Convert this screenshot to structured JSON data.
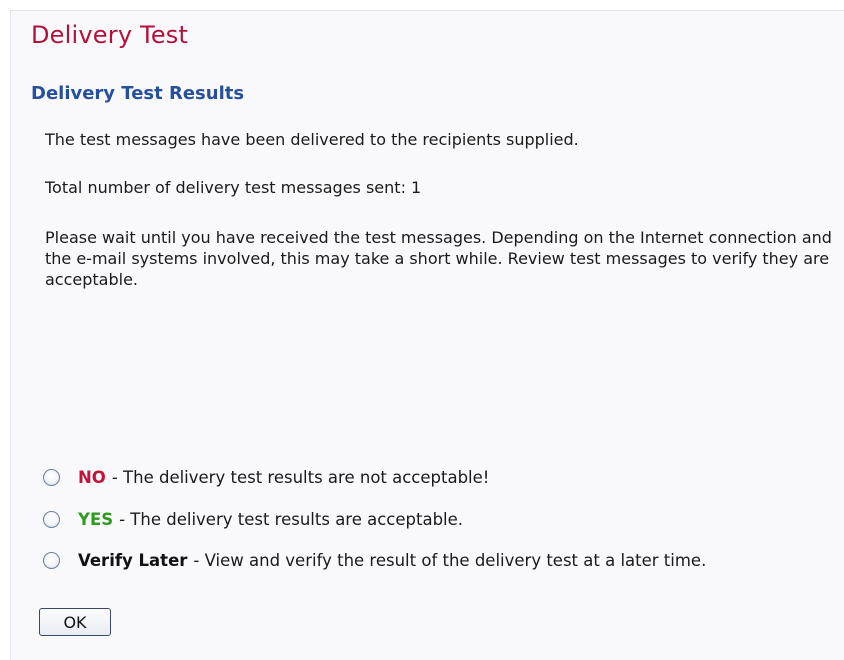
{
  "page": {
    "title": "Delivery Test",
    "subtitle": "Delivery Test Results"
  },
  "body": {
    "line1": "The test messages have been delivered to the recipients supplied.",
    "line2": "Total number of delivery test messages sent: 1",
    "line3": "Please wait until you have received the test messages. Depending on the Internet connection and the e-mail systems involved, this may take a short while. Review test messages to verify they are acceptable."
  },
  "options": [
    {
      "keyword": "NO",
      "text": "- The delivery test results are not acceptable!",
      "color": "#c0143c",
      "selected": false
    },
    {
      "keyword": "YES",
      "text": "- The delivery test results are acceptable.",
      "color": "#2e9a1f",
      "selected": false
    },
    {
      "keyword": "Verify Later",
      "text": "- View and verify the result of the delivery test at a later time.",
      "color": "#111111",
      "selected": false
    }
  ],
  "buttons": {
    "ok_label": "OK"
  },
  "colors": {
    "title": "#b3103a",
    "subtitle": "#27509a",
    "background": "#f9f9fc"
  }
}
